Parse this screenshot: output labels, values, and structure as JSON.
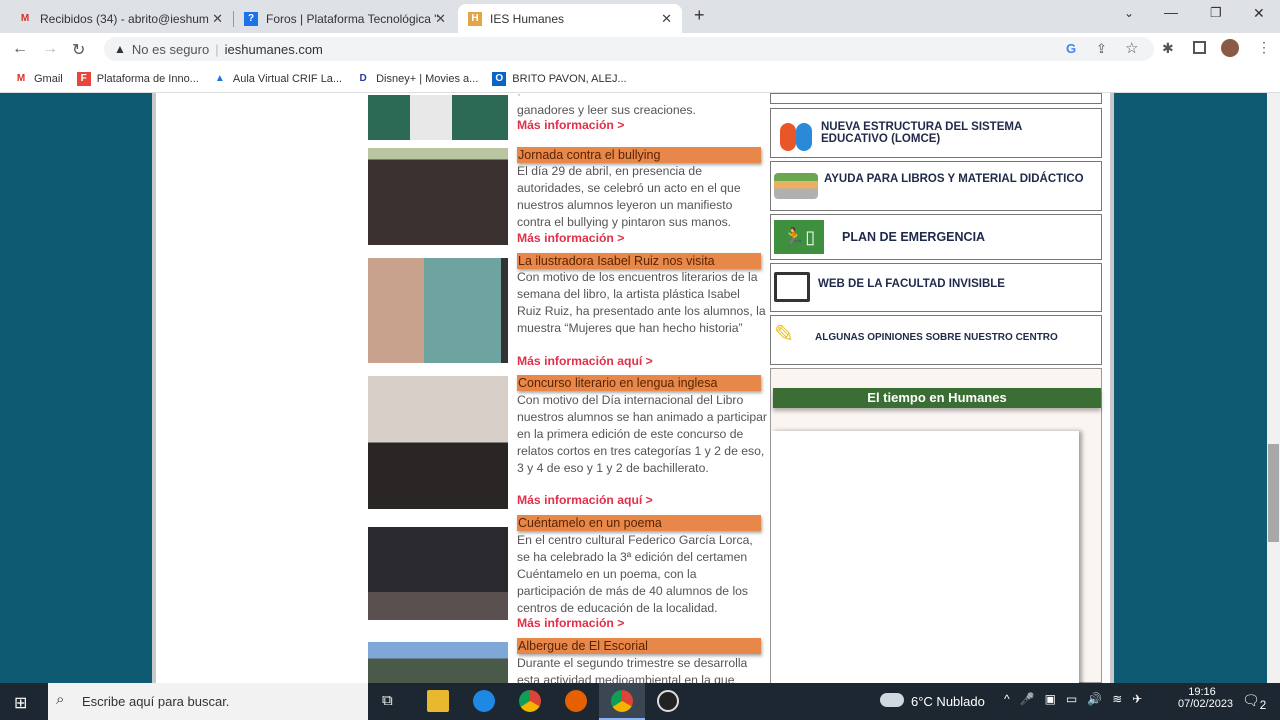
{
  "browser": {
    "tabs": [
      {
        "label": "Recibidos (34) - abrito@ieshum",
        "icon": "gmail-icon",
        "color": "#d93025"
      },
      {
        "label": "Foros | Plataforma Tecnológica \"",
        "icon": "help-icon",
        "color": "#1a73e8"
      },
      {
        "label": "IES Humanes",
        "icon": "ies-icon",
        "color": "#e3a54a"
      }
    ],
    "security": "No es seguro",
    "url": "ieshumanes.com",
    "bookmarks": [
      {
        "label": "Gmail",
        "color": "#d93025"
      },
      {
        "label": "Plataforma de Inno...",
        "color": "#e8453c"
      },
      {
        "label": "Aula Virtual CRIF La...",
        "color": "#1a73e8"
      },
      {
        "label": "Disney+ | Movies a...",
        "color": "#2a3aa0"
      },
      {
        "label": "BRITO PAVON, ALEJ...",
        "color": "#0a64c8"
      }
    ]
  },
  "news": [
    {
      "title": "",
      "body": "ganadores y leer sus creaciones.",
      "link": "Más información >"
    },
    {
      "title": "Jornada contra el bullying",
      "body": "El día 29 de abril, en presencia de autoridades, se celebró un acto en el que nuestros alumnos leyeron un manifiesto contra el bullying y pintaron sus manos.",
      "link": "Más información >"
    },
    {
      "title": "La ilustradora Isabel Ruiz nos visita",
      "body": "Con motivo de los encuentros literarios de la semana del libro, la artista plástica Isabel Ruiz Ruiz, ha presentado ante los alumnos, la muestra “Mujeres que han hecho historia”",
      "link": "Más información aquí >"
    },
    {
      "title": "Concurso literario en lengua inglesa",
      "body": "Con motivo del Día internacional del Libro nuestros alumnos se han animado a participar en la primera edición de este concurso de relatos cortos en tres categorías 1 y 2 de eso, 3 y 4 de eso y 1 y 2 de bachillerato.",
      "link": "Más información aquí >"
    },
    {
      "title": "Cuéntamelo en un poema",
      "body": "En el centro cultural Federico García Lorca, se ha celebrado la 3ª edición del certamen Cuéntamelo en un poema, con la participación de más de 40 alumnos de los centros de educación de la localidad.",
      "link": "Más información >"
    },
    {
      "title": "Albergue de El Escorial",
      "body": "Durante el segundo trimestre se desarrolla esta actividad medioambiental en la que",
      "link": ""
    }
  ],
  "sidebar": [
    {
      "label": "NUEVA ESTRUCTURA DEL SISTEMA EDUCATIVO (LOMCE)",
      "icon": "people-icon"
    },
    {
      "label": "AYUDA PARA LIBROS Y MATERIAL DIDÁCTICO",
      "icon": "books-icon"
    },
    {
      "label": "PLAN DE EMERGENCIA",
      "icon": "emergency-exit-icon"
    },
    {
      "label": "WEB DE LA FACULTAD INVISIBLE",
      "icon": "book-icon"
    },
    {
      "label": "ALGUNAS OPINIONES SOBRE NUESTRO CENTRO",
      "icon": "pencil-icon"
    }
  ],
  "weather": {
    "title": "El tiempo en Humanes"
  },
  "taskbar": {
    "search_placeholder": "Escribe aquí para buscar.",
    "weather": "6°C  Nublado",
    "time": "19:16",
    "date": "07/02/2023",
    "notifications": "2"
  }
}
